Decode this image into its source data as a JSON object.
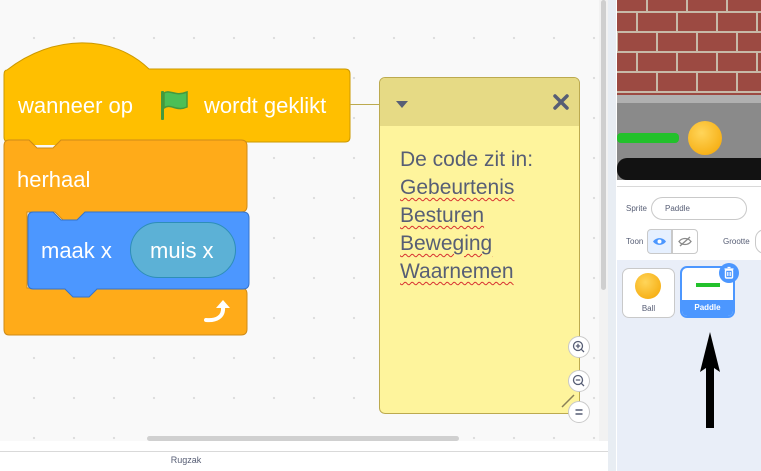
{
  "code_area": {
    "hat_block": {
      "text_before": "wanneer op",
      "icon": "green-flag-icon",
      "text_after": "wordt geklikt"
    },
    "forever_block": {
      "label": "herhaal",
      "icon": "loop-arrow-icon"
    },
    "motion_block": {
      "label": "maak x",
      "reporter": "muis x"
    },
    "comment": {
      "lines": [
        "De code zit in:",
        "Gebeurtenis",
        "Besturen",
        "Beweging",
        "Waarnemen"
      ],
      "icons": [
        "chevron-down-icon",
        "close-icon",
        "resize-icon"
      ]
    },
    "zoom": {
      "icons": [
        "zoom-in-icon",
        "zoom-out-icon",
        "zoom-reset-icon"
      ]
    }
  },
  "backpack": {
    "label": "Rugzak"
  },
  "sprite_info": {
    "sprite_label": "Sprite",
    "sprite_name": "Paddle",
    "show_label": "Toon",
    "size_label": "Grootte"
  },
  "sprites": [
    {
      "name": "Ball",
      "selected": false
    },
    {
      "name": "Paddle",
      "selected": true
    }
  ],
  "colors": {
    "events": "#ffbf00",
    "control": "#ffab19",
    "motion": "#4c97ff",
    "sensing": "#5cb1d6",
    "comment": "#fef49c",
    "selection": "#4c97ff"
  }
}
